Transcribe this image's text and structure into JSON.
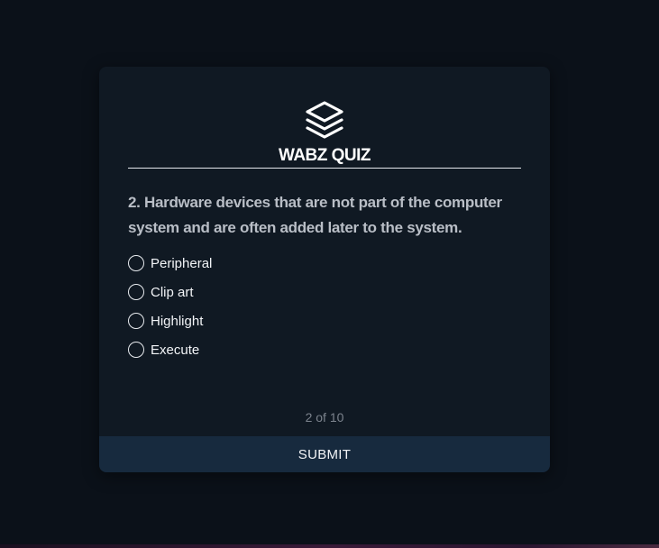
{
  "app": {
    "brand": "WABZ QUIZ",
    "logo_icon": "layers-icon"
  },
  "question": {
    "text": "2. Hardware devices that are not part of the computer system and are often added later to the system."
  },
  "options": [
    {
      "label": "Peripheral",
      "selected": false
    },
    {
      "label": "Clip art",
      "selected": false
    },
    {
      "label": "Highlight",
      "selected": false
    },
    {
      "label": "Execute",
      "selected": false
    }
  ],
  "progress": {
    "text": "2 of 10",
    "current": 2,
    "total": 10
  },
  "actions": {
    "submit_label": "SUBMIT"
  },
  "colors": {
    "background": "#0b1119",
    "card": "#101923",
    "submit_bar": "#172a3e",
    "question_text": "#b9bec6",
    "progress_text": "#7c838d"
  }
}
